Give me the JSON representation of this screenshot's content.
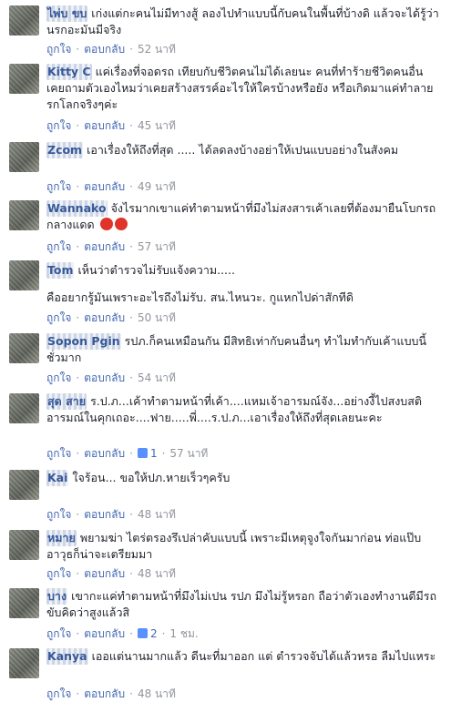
{
  "labels": {
    "like": "ถูกใจ",
    "reply": "ตอบกลับ",
    "dot": "·"
  },
  "comments": [
    {
      "author": "ไพ่บ ขบ",
      "text": "เก่งแต่กะคนไม่มีทางสู้ ลองไปทำแบบนี้กับคนในพื้นที่บ้างดิ แล้วจะได้รู้ว่านรกอะมันมีจริง",
      "time": "52 นาที"
    },
    {
      "author": "Kitty C",
      "text": "แค่เรื่องที่จอดรถ เทียบกับชีวิตคนไม่ได้เลยนะ คนที่ทำร้ายชีวิตคนอื่น เคยถามตัวเองไหมว่าเคยสร้างสรรค์อะไรให้ใครบ้างหรือยัง หรือเกิดมาแค่ทำลาย รกโลกจริงๆค่ะ",
      "time": "45 นาที"
    },
    {
      "author": "Zcom",
      "text": "เอาเรื่องให้ถึงที่สุด ..... ได้ลดลงบ้างอย่าให้เปนแบบอย่างในสังคม",
      "time": "49 นาที"
    },
    {
      "author": "Wannako",
      "text": "จังไรมากเขาแค่ทำตามหน้าที่มึงไม่สงสารเค้าเลยที่ต้องมายืนโบกรถกลางแดด",
      "time": "57 นาที"
    },
    {
      "author": "Tom",
      "text": "เห็นว่าตำรวจไม่รับแจ้งความ.....",
      "text2": "คืออยากรู้มันเพราะอะไรถึงไม่รับ. สน.ไหนวะ. กูแหกไปด่าสักทีดิ",
      "time": "50 นาที"
    },
    {
      "author": "Sopon Pgin",
      "text": "รปภ.ก็คนเหมือนกัน มีสิทธิเท่ากับคนอื่นๆ ทำไมทำกับเค้าแบบนี้ ชั่วมาก",
      "time": "54 นาที"
    },
    {
      "author": "สุด สาย",
      "text": "ร.ป.ภ...เค้าทำตามหน้าที่เค้า....แหมเจ้าอารมณ์จัง...อย่างงี้ไปสงบสติอารมณ์ในคุกเถอะ....ฟาย.....พี่....ร.ป.ภ...เอาเรื่องให้ถึงที่สุดเลยนะคะ",
      "time": "57 นาที",
      "likes": "1"
    },
    {
      "author": "Kai",
      "text": "ใจร้อน... ขอให้ปภ.หายเร็วๆครับ",
      "time": "48 นาที"
    },
    {
      "author": "หมาย",
      "text": "พยามฆ่า ไตร่ตรองรึเปล่าคับแบบนี้ เพราะมีเหตุจูงใจกันมาก่อน ท่อแป๊บอาวุธก็น่าจะเตรียมมา",
      "time": "48 นาที"
    },
    {
      "author": "บาง",
      "text": "เขากะแค่ทำตามหน้าที่มึงไม่เปน รปภ มึงไม่รู้หรอก ถือว่าตัวเองทำงานดีมีรถขับคิดว่าสูงแล้วสิ",
      "time": "1 ชม.",
      "likes": "2"
    },
    {
      "author": "Kanya",
      "text": "เออแต่นานมากแล้ว ดีนะที่มาออก แต่ ตำรวจจับได้แล้วหรอ ลืมไปแหระ",
      "time": "48 นาที"
    }
  ]
}
